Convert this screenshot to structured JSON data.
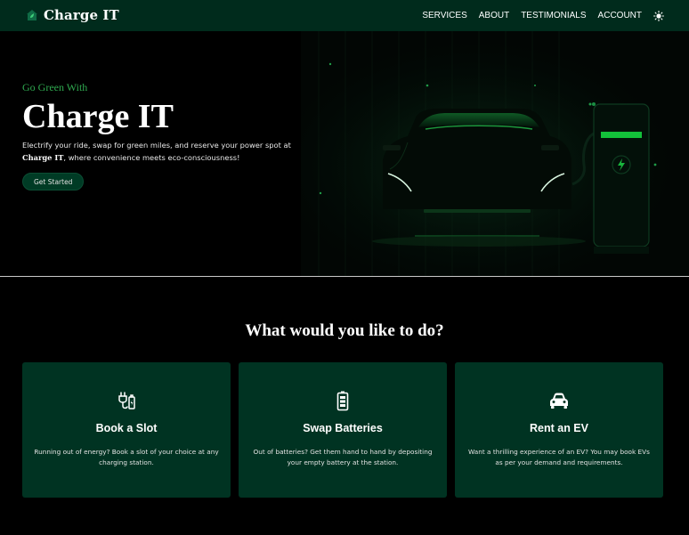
{
  "nav": {
    "brand": "Charge IT",
    "links": [
      "SERVICES",
      "ABOUT",
      "TESTIMONIALS",
      "ACCOUNT"
    ],
    "brand_icon": "house-leaf-icon",
    "theme_icon": "sun-icon"
  },
  "hero": {
    "tagline": "Go Green With",
    "title": "Charge IT",
    "description_prefix": "Electrify your ride, swap for green miles, and reserve your power spot at ",
    "description_brand": "Charge IT",
    "description_suffix": ", where convenience meets eco-consciousness!",
    "cta": "Get Started"
  },
  "services": {
    "title": "What would you like to do?",
    "cards": [
      {
        "title": "Book a Slot",
        "desc": "Running out of energy? Book a slot of your choice at any charging station.",
        "icon": "ev-plug-icon"
      },
      {
        "title": "Swap Batteries",
        "desc": "Out of batteries? Get them hand to hand by depositing your empty battery at the station.",
        "icon": "battery-icon"
      },
      {
        "title": "Rent an EV",
        "desc": "Want a thrilling experience of an EV? You may book EVs as per your demand and requirements.",
        "icon": "car-icon"
      }
    ]
  },
  "colors": {
    "nav_bg": "#002b1c",
    "card_bg": "#003322",
    "accent_green": "#2fa84f",
    "charger_bar": "#13c13a"
  }
}
